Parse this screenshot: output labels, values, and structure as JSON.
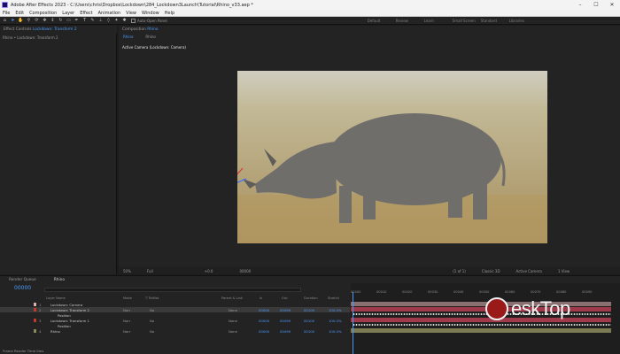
{
  "titlebar": {
    "title": "Adobe After Effects 2023 - C:\\Users\\chris\\Dropbox\\Lockdown\\284_Lockdown3Launch\\Tutorial\\Rhino_v33.aep *",
    "controls": [
      "–",
      "☐",
      "✕"
    ]
  },
  "menus": [
    "File",
    "Edit",
    "Composition",
    "Layer",
    "Effect",
    "Animation",
    "View",
    "Window",
    "Help"
  ],
  "toolbar": {
    "tools": [
      "home-icon",
      "select-icon",
      "hand-icon",
      "zoom-icon",
      "orbit-icon",
      "pan-icon",
      "dolly-icon",
      "rotate-icon",
      "rect-icon",
      "pen-icon",
      "type-icon",
      "brush-icon",
      "stamp-icon",
      "eraser-icon",
      "roto-icon",
      "pin-icon"
    ],
    "snap_label": "Auto-Open Panel",
    "workspaces": [
      "Default",
      "Review",
      "Learn",
      "Small Screen",
      "Standard",
      "Libraries"
    ]
  },
  "left_panel": {
    "tab_prefix": "Effect Controls",
    "tab_layer": "Lockdown: Transform 2",
    "subtitle": "Rhino • Lockdown: Transform 2"
  },
  "comp_panel": {
    "tab_prefix": "Composition",
    "tab_comp": "Rhino",
    "sub_tabs": [
      "Rhino",
      "Rhino"
    ],
    "active_camera": "Active Camera (Lockdown: Camera)"
  },
  "viewer_bar": {
    "zoom": "50%",
    "resolution": "Full",
    "exposure": "+0.0",
    "timecode": "00000",
    "frame": "(1 of 1)",
    "renderer": "Classic 3D",
    "camera": "Active Camera",
    "views": "1 View"
  },
  "timeline": {
    "tabs": [
      "Render Queue",
      "Rhino"
    ],
    "timecode": "00000",
    "columns": [
      "Layer Name",
      "Mode",
      "T TrkMat",
      "Parent & Link",
      "In",
      "Out",
      "Duration",
      "Stretch"
    ],
    "ruler": [
      "00000",
      "00010",
      "00020",
      "00030",
      "00040",
      "00050",
      "00060",
      "00070",
      "00080",
      "00090"
    ],
    "footer": "Frame Render Time  0ms",
    "layers": [
      {
        "num": "1",
        "name": "Lockdown: Camera",
        "mode": "",
        "trk": "",
        "parent": "",
        "in": "",
        "out": "",
        "dur": "",
        "str": "",
        "prop": "",
        "color": "#d8b0b0",
        "selected": false
      },
      {
        "num": "2",
        "name": "Lockdown: Transform 2",
        "mode": "Norr",
        "trk": "No",
        "parent": "None",
        "in": "00000",
        "out": "00099",
        "dur": "00100",
        "str": "100.0%",
        "prop": "",
        "color": "#c0392b",
        "selected": true
      },
      {
        "num": "",
        "name": "Position",
        "mode": "",
        "trk": "",
        "parent": "",
        "in": "",
        "out": "",
        "dur": "",
        "str": "",
        "prop": "",
        "color": "",
        "selected": false
      },
      {
        "num": "3",
        "name": "Lockdown: Transform 1",
        "mode": "Norr",
        "trk": "No",
        "parent": "None",
        "in": "00000",
        "out": "00099",
        "dur": "00100",
        "str": "100.0%",
        "prop": "",
        "color": "#c0392b",
        "selected": false
      },
      {
        "num": "",
        "name": "Position",
        "mode": "",
        "trk": "",
        "parent": "",
        "in": "",
        "out": "",
        "dur": "",
        "str": "",
        "prop": "",
        "color": "",
        "selected": false
      },
      {
        "num": "4",
        "name": "Rhino",
        "mode": "Norr",
        "trk": "No",
        "parent": "None",
        "in": "00000",
        "out": "00099",
        "dur": "00100",
        "str": "100.0%",
        "prop": "",
        "color": "#8a8a5a",
        "selected": false
      }
    ]
  },
  "watermark": {
    "text": "eskTop"
  },
  "colors": {
    "accent": "#4b9bff",
    "panel": "#232323",
    "track": "#a03a4a"
  }
}
